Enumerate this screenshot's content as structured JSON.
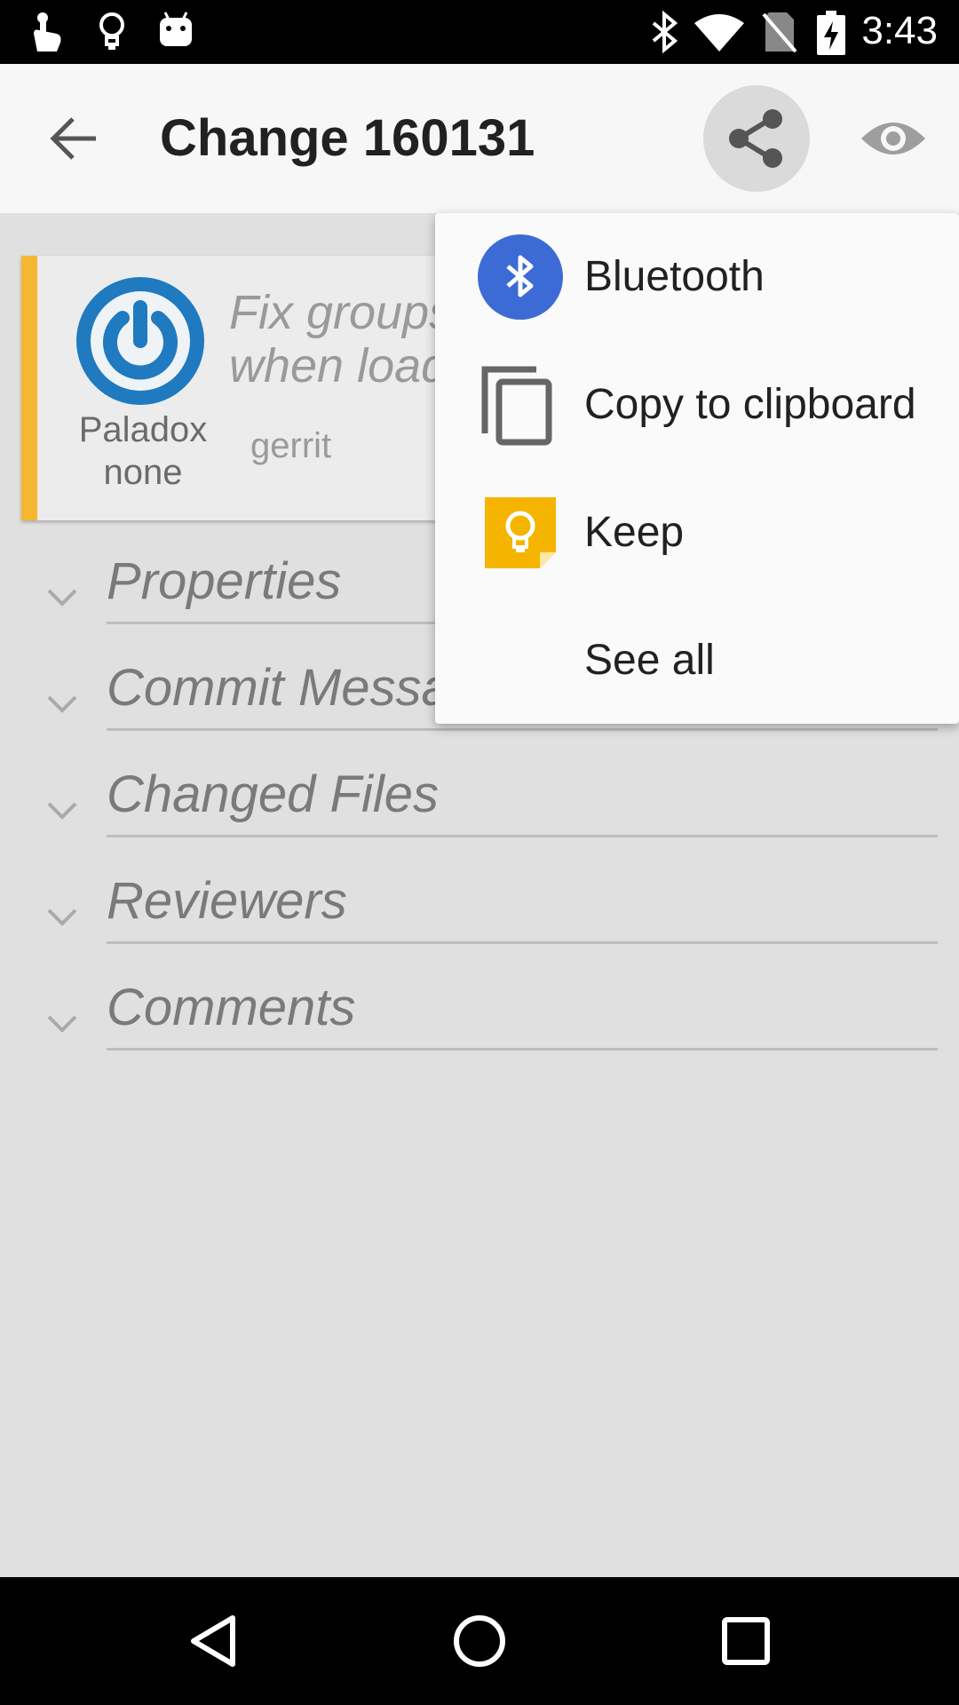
{
  "status_bar": {
    "time": "3:43",
    "left_icons": [
      "touch-icon",
      "lightbulb-icon",
      "android-icon"
    ],
    "right_icons": [
      "bluetooth-icon",
      "wifi-icon",
      "no-sim-icon",
      "battery-charging-icon"
    ]
  },
  "toolbar": {
    "back_icon": "arrow-back-icon",
    "title": "Change 160131",
    "share_icon": "share-icon",
    "watch_icon": "eye-icon"
  },
  "change_card": {
    "owner_name": "Paladox",
    "owner_status": "none",
    "subject_line1": "Fix groups",
    "subject_line2": "when load",
    "project": "gerrit",
    "accent_color": "#f5b731",
    "avatar_color": "#1f7ac0"
  },
  "sections": [
    {
      "label": "Properties"
    },
    {
      "label": "Commit Messa"
    },
    {
      "label": "Changed Files"
    },
    {
      "label": "Reviewers"
    },
    {
      "label": "Comments"
    }
  ],
  "share_menu": {
    "items": [
      {
        "label": "Bluetooth",
        "icon": "bluetooth-icon"
      },
      {
        "label": "Copy to clipboard",
        "icon": "copy-icon"
      },
      {
        "label": "Keep",
        "icon": "keep-icon"
      },
      {
        "label": "See all",
        "icon": ""
      }
    ]
  },
  "nav_bar": {
    "icons": [
      "back-triangle-icon",
      "home-circle-icon",
      "recents-square-icon"
    ]
  }
}
